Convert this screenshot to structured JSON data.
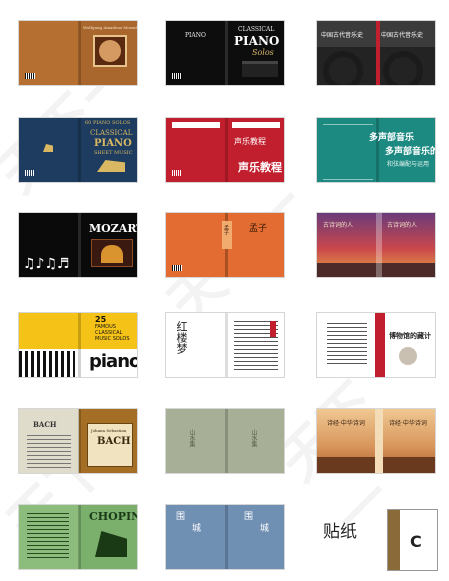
{
  "watermark": {
    "text": "天下一"
  },
  "covers": [
    {
      "id": "wolfgang",
      "lines": [
        "Wolfgang Amadeus Mozart"
      ],
      "colors": {
        "bg": "#a9662d",
        "accent": "#6a3012"
      }
    },
    {
      "id": "classical-solos",
      "lines": [
        "CLASSICAL",
        "PIANO",
        "Solos"
      ],
      "colors": {
        "bg": "#0d0d0d",
        "accent": "#f5f5f5"
      }
    },
    {
      "id": "chinese-history",
      "lines": [
        "中国古代音乐史",
        "中国古代音乐史"
      ],
      "colors": {
        "bg": "#3a3a3a",
        "accent": "#c0182a"
      }
    },
    {
      "id": "sheet-music",
      "lines": [
        "60 PIANO SOLOS",
        "CLASSICAL",
        "PIANO",
        "SHEET MUSIC"
      ],
      "colors": {
        "bg": "#1d3c5f",
        "accent": "#d9b763"
      }
    },
    {
      "id": "vocal",
      "lines": [
        "声乐教程",
        "声乐教程"
      ],
      "colors": {
        "bg": "#c21f2e",
        "accent": "#ffffff"
      }
    },
    {
      "id": "polyphonic",
      "lines": [
        "多声部音乐",
        "多声部音乐的",
        "和弦编配与运用"
      ],
      "colors": {
        "bg": "#1d8a82",
        "accent": "#ffffff"
      }
    },
    {
      "id": "mozart",
      "lines": [
        "MOZART",
        "♫♪♫♬"
      ],
      "colors": {
        "bg": "#0a0a0a",
        "accent": "#ffffff"
      }
    },
    {
      "id": "mengzi",
      "lines": [
        "孟子",
        "孟子"
      ],
      "colors": {
        "bg": "#e26c31",
        "accent": "#3b1b08"
      }
    },
    {
      "id": "sunset",
      "lines": [
        "古诗词的人",
        "古诗词的人"
      ],
      "colors": {
        "bg": "#b85a4a",
        "accent": "#f4e4c8"
      }
    },
    {
      "id": "famous-solos",
      "lines": [
        "25",
        "FAMOUS",
        "CLASSICAL",
        "MUSIC SOLOS",
        "piano"
      ],
      "colors": {
        "bg": "#f5c317",
        "accent": "#111111"
      }
    },
    {
      "id": "red-mansions",
      "lines": [
        "红楼梦"
      ],
      "colors": {
        "bg": "#ffffff",
        "accent": "#c21f2e"
      }
    },
    {
      "id": "museum",
      "lines": [
        "博物馆的藏计"
      ],
      "colors": {
        "bg": "#ffffff",
        "accent": "#c21f2e"
      }
    },
    {
      "id": "bach",
      "lines": [
        "BACH",
        "Johann Sebastian",
        "BACH"
      ],
      "colors": {
        "bg": "#e0dccb",
        "accent": "#a46e24"
      }
    },
    {
      "id": "sage-book",
      "lines": [
        "山水集",
        "山水集"
      ],
      "colors": {
        "bg": "#a7b096",
        "accent": "#555a48"
      }
    },
    {
      "id": "landscape",
      "lines": [
        "诗经·中华诗词",
        "诗经·中华诗词"
      ],
      "colors": {
        "bg": "#d7955a",
        "accent": "#3b2210"
      }
    },
    {
      "id": "chopin",
      "lines": [
        "CHOPIN"
      ],
      "colors": {
        "bg": "#7aaf6c",
        "accent": "#1a3a16"
      }
    },
    {
      "id": "blue-book",
      "lines": [
        "围",
        "城",
        "围",
        "城"
      ],
      "colors": {
        "bg": "#6f8fb3",
        "accent": "#ffffff"
      }
    }
  ],
  "sticker": {
    "label": "贴纸",
    "letter": "C",
    "colors": {
      "band": "#8a6a38",
      "card": "#ffffff"
    }
  }
}
